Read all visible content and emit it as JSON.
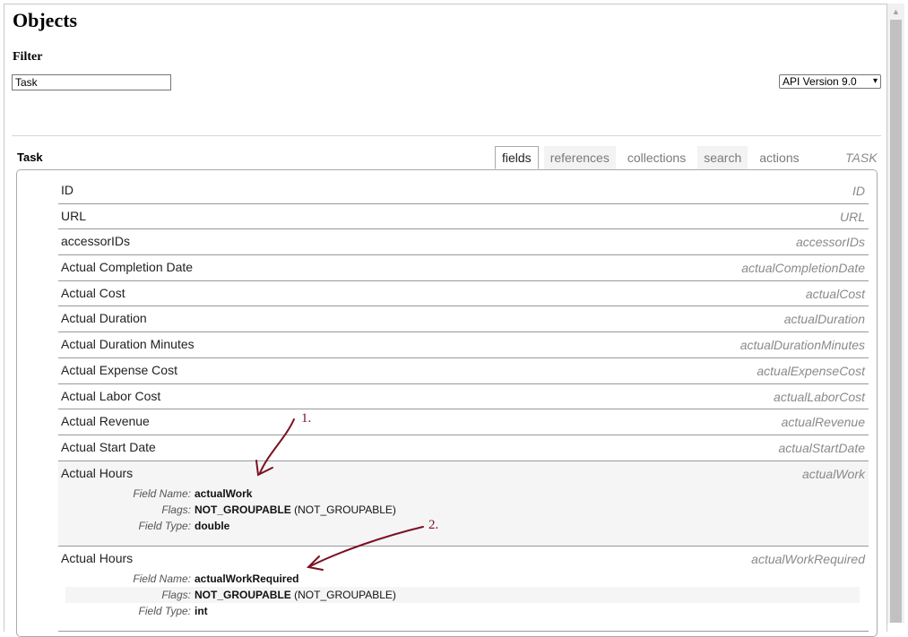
{
  "page": {
    "title": "Objects",
    "filter_label": "Filter",
    "filter_value": "Task",
    "api_version": "API Version 9.0"
  },
  "object": {
    "name": "Task",
    "code": "TASK",
    "tabs": [
      {
        "label": "fields",
        "active": true
      },
      {
        "label": "references",
        "active": false
      },
      {
        "label": "collections",
        "active": false
      },
      {
        "label": "search",
        "active": false
      },
      {
        "label": "actions",
        "active": false
      }
    ]
  },
  "fields": [
    {
      "label": "ID",
      "code": "ID"
    },
    {
      "label": "URL",
      "code": "URL"
    },
    {
      "label": "accessorIDs",
      "code": "accessorIDs"
    },
    {
      "label": "Actual Completion Date",
      "code": "actualCompletionDate"
    },
    {
      "label": "Actual Cost",
      "code": "actualCost"
    },
    {
      "label": "Actual Duration",
      "code": "actualDuration"
    },
    {
      "label": "Actual Duration Minutes",
      "code": "actualDurationMinutes"
    },
    {
      "label": "Actual Expense Cost",
      "code": "actualExpenseCost"
    },
    {
      "label": "Actual Labor Cost",
      "code": "actualLaborCost"
    },
    {
      "label": "Actual Revenue",
      "code": "actualRevenue"
    },
    {
      "label": "Actual Start Date",
      "code": "actualStartDate"
    }
  ],
  "expanded": [
    {
      "label": "Actual Hours",
      "code": "actualWork",
      "field_name_key": "Field Name:",
      "field_name": "actualWork",
      "flags_key": "Flags:",
      "flags_bold": "NOT_GROUPABLE",
      "flags_rest": " (NOT_GROUPABLE)",
      "type_key": "Field Type:",
      "type": "double"
    },
    {
      "label": "Actual Hours",
      "code": "actualWorkRequired",
      "field_name_key": "Field Name:",
      "field_name": "actualWorkRequired",
      "flags_key": "Flags:",
      "flags_bold": "NOT_GROUPABLE",
      "flags_rest": " (NOT_GROUPABLE)",
      "type_key": "Field Type:",
      "type": "int"
    }
  ],
  "annotations": {
    "first": "1.",
    "second": "2.",
    "color": "#7b1020"
  },
  "icons": {
    "select_chevron": "chevron-down-icon",
    "scroll_up": "scroll-up-arrow-icon"
  }
}
